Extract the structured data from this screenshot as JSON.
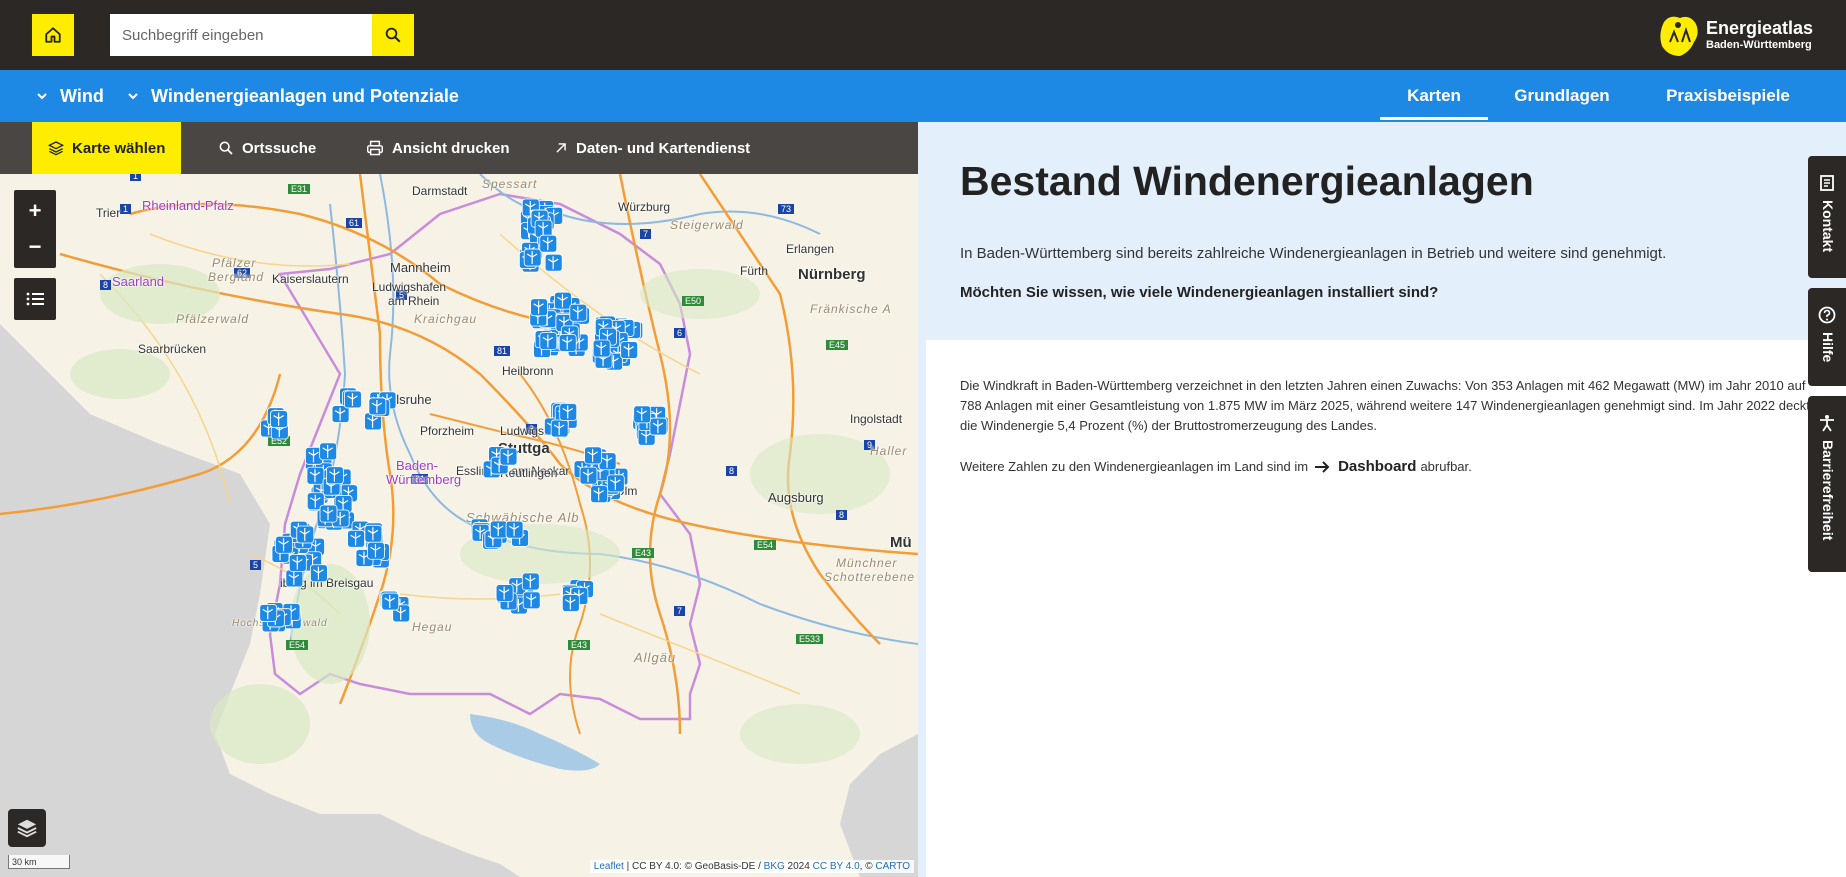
{
  "header": {
    "search_placeholder": "Suchbegriff eingeben",
    "logo_title": "Energieatlas",
    "logo_subtitle": "Baden-Württemberg"
  },
  "nav": {
    "breadcrumb": [
      "Wind",
      "Windenergieanlagen und Potenziale"
    ],
    "tabs": [
      {
        "label": "Karten",
        "active": true
      },
      {
        "label": "Grundlagen",
        "active": false
      },
      {
        "label": "Praxisbeispiele",
        "active": false
      }
    ]
  },
  "map_toolbar": {
    "select_map": "Karte wählen",
    "location_search": "Ortssuche",
    "print_view": "Ansicht drucken",
    "data_services": "Daten- und Kartendienst"
  },
  "map": {
    "zoom_in": "+",
    "zoom_out": "−",
    "scale": "30 km",
    "attribution_leaflet": "Leaflet",
    "attribution_text": " | CC BY 4.0: © GeoBasis-DE / ",
    "attribution_bkg": "BKG",
    "attribution_year": " 2024 ",
    "attribution_cc": "CC BY 4.0",
    "attribution_sep": ", © ",
    "attribution_carto": "CARTO",
    "places": {
      "darmstadt": "Darmstadt",
      "spessart": "Spessart",
      "wuerzburg": "Würzburg",
      "trier": "Trier",
      "rheinland_pfalz": "Rheinland-Pfalz",
      "steigerwald": "Steigerwald",
      "erlangen": "Erlangen",
      "mannheim": "Mannheim",
      "pfaelzer_bergland_1": "Pfälzer",
      "pfaelzer_bergland_2": "Bergland",
      "kaiserslautern": "Kaiserslautern",
      "ludwigshafen_1": "Ludwigshafen",
      "ludwigshafen_2": "am Rhein",
      "fuerth": "Fürth",
      "nuernberg": "Nürnberg",
      "saarland": "Saarland",
      "saarbruecken": "Saarbrücken",
      "pfaelzerwald": "Pfälzerwald",
      "fraenkische_alb": "Fränkische A",
      "kraichgau": "Kraichgau",
      "heilbronn": "Heilbronn",
      "karlsruhe": "Karlsruhe",
      "pforzheim": "Pforzheim",
      "ludwigsburg": "Ludwigsburg",
      "stuttgart": "Stuttga",
      "ingolstadt": "Ingolstadt",
      "esslingen": "Esslingen am Neckar",
      "hallert": "Haller",
      "bw_1": "Baden-",
      "bw_2": "Württemberg",
      "reutlingen": "Reutlingen",
      "ulm": "Ulm",
      "augsburg": "Augsburg",
      "schwaebische_alb": "Schwäbische Alb",
      "muenchen": "Mü",
      "muenchner_schotterebene_1": "Münchner",
      "muenchner_schotterebene_2": "Schotterebene",
      "freiburg": "iburg im Breisgau",
      "hegau": "Hegau",
      "hochschwarzwald": "Hochschwarzwald",
      "allgaeu": "Allgäu"
    },
    "road_labels": {
      "a1": "1",
      "a61": "61",
      "a62": "62",
      "a6": "6",
      "a5": "5",
      "a81": "81",
      "a7": "7",
      "a3": "3",
      "a73": "73",
      "a9": "9",
      "a8": "8",
      "e52": "E52",
      "e31": "E31",
      "e50": "E50",
      "e45": "E45",
      "e43": "E43",
      "e54": "E54",
      "e533": "E533"
    }
  },
  "panel": {
    "title": "Bestand Windenergieanlagen",
    "intro": "In Baden-Württemberg sind bereits zahlreiche Windenergieanlagen in Betrieb und weitere sind genehmigt.",
    "question": "Möchten Sie wissen, wie viele Windenergieanlagen installiert sind?",
    "body": "Die Windkraft in Baden-Württemberg verzeichnet in den letzten Jahren einen Zuwachs: Von 353 Anlagen mit 462 Megawatt (MW) im Jahr 2010 auf 788 Anlagen mit einer Gesamtleistung von 1.875 MW im März 2025, während weitere 147 Windenergieanlagen genehmigt sind. Im Jahr 2022 deckt die Windenergie 5,4 Prozent (%) der Bruttostromerzeugung des Landes.",
    "more_prefix": "Weitere Zahlen zu den Windenergieanlagen im Land sind im",
    "more_link": "Dashboard",
    "more_suffix": "abrufbar."
  },
  "side_tabs": [
    "Kontakt",
    "Hilfe",
    "Barrierefreiheit"
  ],
  "colors": {
    "topbar": "#2b2826",
    "accent_yellow": "#ffed00",
    "nav_blue": "#1e88e5",
    "panel_bg": "#e3f0fc",
    "marker_blue": "#1e88e5"
  }
}
